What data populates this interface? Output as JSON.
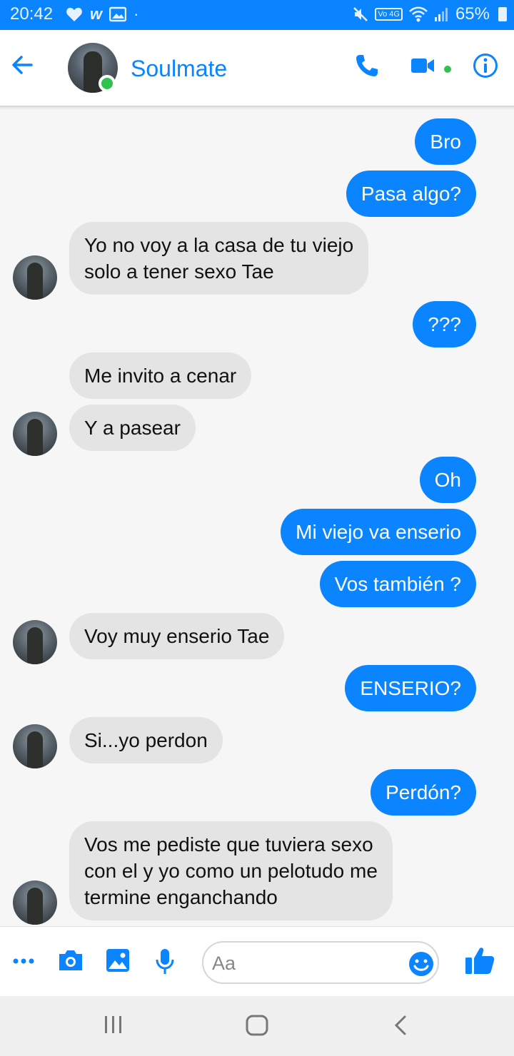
{
  "status_bar": {
    "time": "20:42",
    "network_badge": "Vo 4G",
    "battery": "65%"
  },
  "header": {
    "contact_name": "Soulmate",
    "online": true
  },
  "messages": [
    {
      "from": "me",
      "text": "Bro"
    },
    {
      "from": "me",
      "text": "Pasa algo?"
    },
    {
      "from": "them",
      "lines": [
        "Yo no voy a la casa de tu viejo",
        "solo a tener sexo Tae"
      ]
    },
    {
      "from": "me",
      "text": "???"
    },
    {
      "from": "them",
      "text": "Me invito a cenar"
    },
    {
      "from": "them",
      "text": "Y a pasear"
    },
    {
      "from": "me",
      "text": "Oh"
    },
    {
      "from": "me",
      "text": "Mi viejo va enserio"
    },
    {
      "from": "me",
      "text": "Vos también ?"
    },
    {
      "from": "them",
      "text": "Voy muy enserio Tae"
    },
    {
      "from": "me",
      "text": "ENSERIO?"
    },
    {
      "from": "them",
      "text": "Si...yo perdon"
    },
    {
      "from": "me",
      "text": "Perdón?"
    },
    {
      "from": "them",
      "lines": [
        "Vos me pediste que tuviera sexo",
        "con el y yo como un pelotudo me",
        "termine enganchando"
      ]
    }
  ],
  "composer": {
    "placeholder": "Aa"
  },
  "colors": {
    "accent": "#0a84ff",
    "incoming_bubble": "#e4e4e4",
    "online_dot": "#31c24d"
  },
  "icons": [
    "heart-icon",
    "w-app-icon",
    "gallery-icon",
    "mute-icon",
    "wifi-icon",
    "signal-icon",
    "battery-icon",
    "back-arrow-icon",
    "phone-icon",
    "video-icon",
    "info-icon",
    "more-icon",
    "camera-icon",
    "image-icon",
    "mic-icon",
    "emoji-icon",
    "like-icon",
    "recents-icon",
    "home-icon",
    "back-nav-icon"
  ]
}
